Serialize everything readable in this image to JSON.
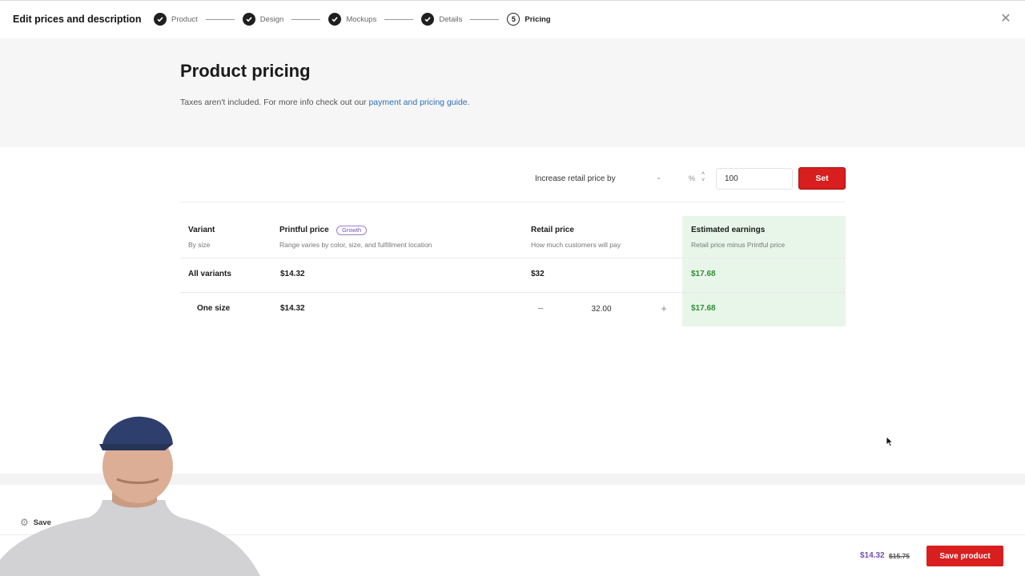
{
  "header": {
    "title": "Edit prices and description",
    "steps": [
      {
        "label": "Product",
        "status": "done"
      },
      {
        "label": "Design",
        "status": "done"
      },
      {
        "label": "Mockups",
        "status": "done"
      },
      {
        "label": "Details",
        "status": "done"
      },
      {
        "label": "Pricing",
        "status": "current",
        "number": "5"
      }
    ],
    "close_icon": "close-icon"
  },
  "intro": {
    "title": "Product pricing",
    "text": "Taxes aren't included. For more info check out our ",
    "link": "payment and pricing guide."
  },
  "bulk": {
    "mode_label": "Increase retail price by",
    "unit": "%",
    "value": "100",
    "set_label": "Set"
  },
  "table": {
    "columns": [
      {
        "title": "Variant",
        "subtitle": "By size"
      },
      {
        "title": "Printful price",
        "subtitle": "Range varies by color, size, and fulfillment location",
        "badge": "Growth"
      },
      {
        "title": "Retail price",
        "subtitle": "How much customers will pay"
      },
      {
        "title": "Estimated earnings",
        "subtitle": "Retail price minus Printful price"
      }
    ],
    "rows": [
      {
        "variant": "All variants",
        "printful": "$14.32",
        "retail": "$32",
        "earnings": "$17.68"
      },
      {
        "variant": "One size",
        "printful": "$14.32",
        "retail": "32.00",
        "earnings": "$17.68"
      }
    ]
  },
  "footer": {
    "price": "$14.32",
    "old_price": "$15.75",
    "save_label": "Save product",
    "draft_label": "Save"
  },
  "colors": {
    "accent_red": "#d81e1e",
    "earnings_green": "#2f8f34",
    "earnings_bg": "#e8f6e9",
    "badge_purple": "#7350b6",
    "link_blue": "#2a6fb8"
  }
}
